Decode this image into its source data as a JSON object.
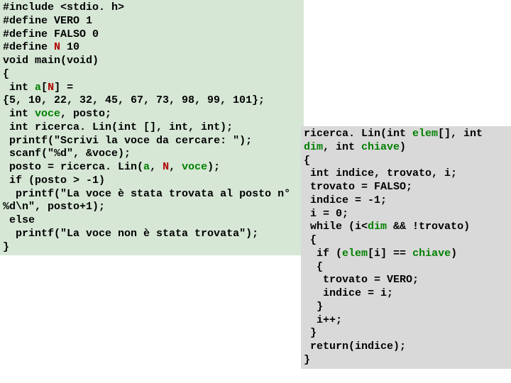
{
  "left": {
    "l1a": "#include <stdio. h>",
    "l2a": "#define VERO 1",
    "l3a": "#define FALSO 0",
    "l4a": "#define ",
    "l4b": "N",
    "l4c": " 10",
    "l5a": "void main(void)",
    "l6a": "{",
    "l7a": " int ",
    "l7b": "a",
    "l7c": "[",
    "l7d": "N",
    "l7e": "] =",
    "l8a": "{5, 10, 22, 32, 45, 67, 73, 98, 99, 101};",
    "l9a": " int ",
    "l9b": "voce",
    "l9c": ", posto;",
    "l10a": " int ricerca. Lin(int [], int, int);",
    "l11a": " printf(\"Scrivi la voce da cercare: \");",
    "l12a": " scanf(\"%d\", &voce);",
    "l13a": " posto = ricerca. Lin(",
    "l13b": "a",
    "l13c": ", ",
    "l13d": "N",
    "l13e": ", ",
    "l13f": "voce",
    "l13g": ");",
    "l14a": " if (posto > -1)",
    "l15a": "  printf(\"La voce è stata trovata al posto n° %d\\n\", posto+1);",
    "l16a": " else",
    "l17a": "  printf(\"La voce non è stata trovata\");",
    "l18a": "}"
  },
  "right": {
    "l1a": "ricerca. Lin(int ",
    "l1b": "elem",
    "l1c": "[], int ",
    "l1d": "dim",
    "l1e": ", int ",
    "l1f": "chiave",
    "l1g": ")",
    "l2a": "{",
    "l3a": " int indice, trovato, i;",
    "l4a": " trovato = FALSO;",
    "l5a": " indice = -1;",
    "l6a": " i = 0;",
    "l7a": " while (i<",
    "l7b": "dim",
    "l7c": " && !trovato)",
    "l8a": " {",
    "l9a": "  if (",
    "l9b": "elem",
    "l9c": "[i] == ",
    "l9d": "chiave",
    "l9e": ")",
    "l10a": "  {",
    "l11a": "   trovato = VERO;",
    "l12a": "   indice = i;",
    "l13a": "  }",
    "l14a": "  i++;",
    "l15a": " }",
    "l16a": " return(indice);",
    "l17a": "}"
  }
}
